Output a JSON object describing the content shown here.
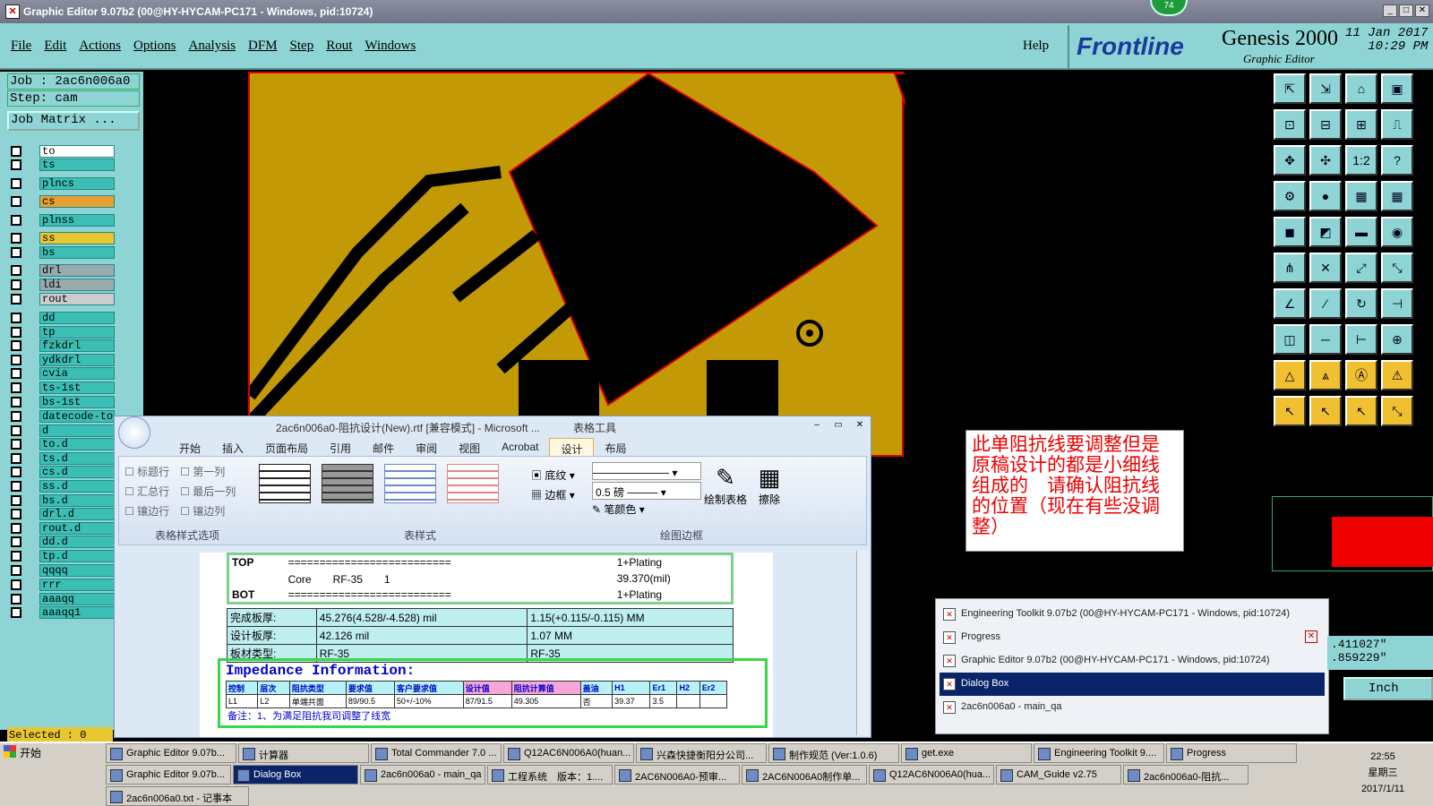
{
  "title_bar": {
    "text": "Graphic Editor 9.07b2 (00@HY-HYCAM-PC171 - Windows, pid:10724)",
    "badge": "74"
  },
  "menu": [
    "File",
    "Edit",
    "Actions",
    "Options",
    "Analysis",
    "DFM",
    "Step",
    "Rout",
    "Windows"
  ],
  "help": "Help",
  "brand": {
    "logo": "Frontline",
    "product": "Genesis 2000",
    "subtitle": "Graphic Editor",
    "date": "11 Jan 2017",
    "time": "10:29 PM"
  },
  "job": {
    "job_label": "Job : 2ac6n006a0",
    "step_label": "Step: cam",
    "matrix_button": "Job Matrix ..."
  },
  "layers": [
    "to",
    "ts",
    "plncs",
    "cs",
    "plnss",
    "ss",
    "bs",
    "drl",
    "ldi",
    "rout",
    "dd",
    "tp",
    "fzkdrl",
    "ydkdrl",
    "cvia",
    "ts-1st",
    "bs-1st",
    "datecode-to",
    "d",
    "to.d",
    "ts.d",
    "cs.d",
    "ss.d",
    "bs.d",
    "drl.d",
    "rout.d",
    "dd.d",
    "tp.d",
    "qqqq",
    "rrr",
    "aaaqq",
    "aaaqq1"
  ],
  "selected": "Selected : 0",
  "note": "此单阻抗线要调整但是原稿设计的都是小细线组成的　请确认阻抗线的位置（现在有些没调整）",
  "word": {
    "title": "2ac6n006a0-阻抗设计(New).rtf [兼容模式] - Microsoft ...",
    "context_tab": "表格工具",
    "tabs": [
      "开始",
      "插入",
      "页面布局",
      "引用",
      "邮件",
      "审阅",
      "视图",
      "Acrobat",
      "设计",
      "布局"
    ],
    "options": [
      "标题行",
      "第一列",
      "汇总行",
      "最后一列",
      "镶边行",
      "镶边列"
    ],
    "shading": "底纹",
    "borders": "边框",
    "pen_weight": "0.5 磅",
    "pen_color": "笔颜色",
    "draw_table": "绘制表格",
    "eraser": "擦除",
    "groups": [
      "表格样式选项",
      "表样式",
      "绘图边框"
    ],
    "stack": [
      [
        "TOP",
        "==========================",
        "1+Plating"
      ],
      [
        "",
        "Core　　RF-35　　1",
        "39.370(mil)"
      ],
      [
        "BOT",
        "==========================",
        "1+Plating"
      ]
    ],
    "info": [
      [
        "完成板厚:",
        "45.276(4.528/-4.528) mil",
        "1.15(+0.115/-0.115) MM"
      ],
      [
        "设计板厚:",
        "42.126 mil",
        "1.07 MM"
      ],
      [
        "板材类型:",
        "RF-35",
        "RF-35"
      ]
    ],
    "impedance_title": "Impedance Information:",
    "imp_headers": [
      "控制",
      "层次",
      "阻抗类型",
      "要求值",
      "客户要求值",
      "设计值",
      "阻抗计算值",
      "盖油",
      "H1",
      "Er1",
      "H2",
      "Er2"
    ],
    "imp_row": [
      "L1",
      "L2",
      "单端共面",
      "89/90.5",
      "50+/-10%",
      "87/91.5",
      "49.305",
      "否",
      "39.37",
      "3.5",
      "",
      ""
    ],
    "remark": "备注：1、为满足阻抗我司调整了线宽"
  },
  "toolkit_items": [
    "Engineering Toolkit 9.07b2 (00@HY-HYCAM-PC171 - Windows, pid:10724)",
    "Progress",
    "Graphic Editor 9.07b2 (00@HY-HYCAM-PC171 - Windows, pid:10724)",
    "Dialog Box",
    "2ac6n006a0 - main_qa"
  ],
  "coords": {
    "x": ".411027\"",
    "y": ".859229\""
  },
  "units": "Inch",
  "taskbar": {
    "start": "开始",
    "row1": [
      "Graphic Editor 9.07b...",
      "计算器",
      "Total Commander 7.0 ...",
      "Q12AC6N006A0(huan...",
      "兴森快捷衡阳分公司...",
      "制作规范 (Ver:1.0.6)",
      "get.exe",
      "Engineering Toolkit 9....",
      "Progress"
    ],
    "row2": [
      "Graphic Editor 9.07b...",
      "Dialog Box",
      "2ac6n006a0 - main_qa",
      "工程系统　版本：1....",
      "2AC6N006A0-预审...",
      "2AC6N006A0制作单...",
      "Q12AC6N006A0(hua...",
      "CAM_Guide v2.75",
      "2ac6n006a0-阻抗..."
    ],
    "row3": [
      "2ac6n006a0.txt - 记事本"
    ],
    "clock": {
      "time": "22:55",
      "day": "星期三",
      "date": "2017/1/11"
    }
  }
}
